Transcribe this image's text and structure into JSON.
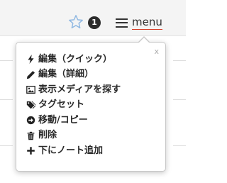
{
  "header": {
    "notification_count": "1",
    "menu_label": "menu",
    "accent_color": "#d6402a"
  },
  "popover": {
    "close_label": "x",
    "items": [
      {
        "icon": "bolt-icon",
        "label": "編集（クイック）"
      },
      {
        "icon": "pencil-icon",
        "label": "編集（詳細）"
      },
      {
        "icon": "image-icon",
        "label": "表示メディアを探す"
      },
      {
        "icon": "tags-icon",
        "label": "タグセット"
      },
      {
        "icon": "arrow-circle-right-icon",
        "label": "移動/コピー"
      },
      {
        "icon": "trash-icon",
        "label": "削除"
      },
      {
        "icon": "plus-icon",
        "label": "下にノート追加"
      }
    ]
  }
}
